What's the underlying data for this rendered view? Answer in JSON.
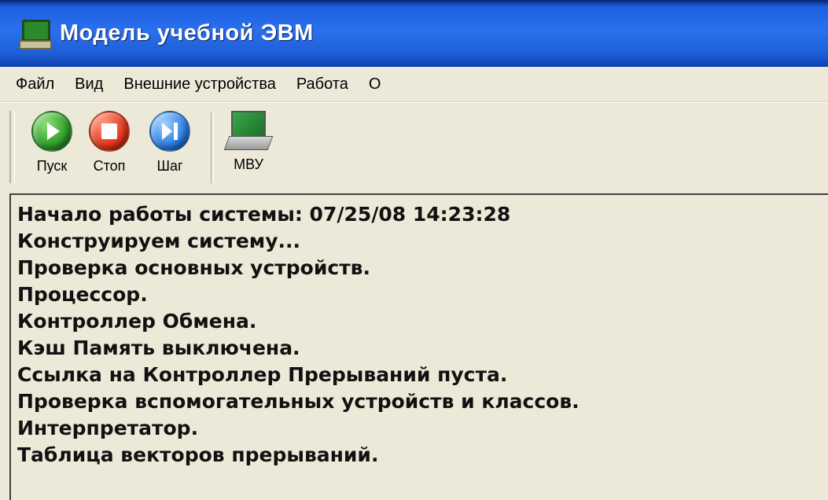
{
  "window": {
    "title": "Модель учебной ЭВМ",
    "icon": "computer-icon"
  },
  "menu": [
    "Файл",
    "Вид",
    "Внешние устройства",
    "Работа",
    "О"
  ],
  "toolbar": {
    "start_label": "Пуск",
    "stop_label": "Стоп",
    "step_label": "Шаг",
    "mvu_label": "МВУ"
  },
  "log": [
    "Начало работы системы: 07/25/08 14:23:28",
    "Конструируем систему...",
    "Проверка основных устройств.",
    "Процессор.",
    "Контроллер Обмена.",
    "Кэш Память выключена.",
    "Ссылка на Контроллер Прерываний пуста.",
    "Проверка вспомогательных устройств и классов.",
    "Интерпретатор.",
    "Таблица векторов прерываний."
  ],
  "colors": {
    "titlebar": "#2a70ee",
    "start": "#2f9e2a",
    "stop": "#e0361a",
    "step": "#2a7fe0"
  }
}
